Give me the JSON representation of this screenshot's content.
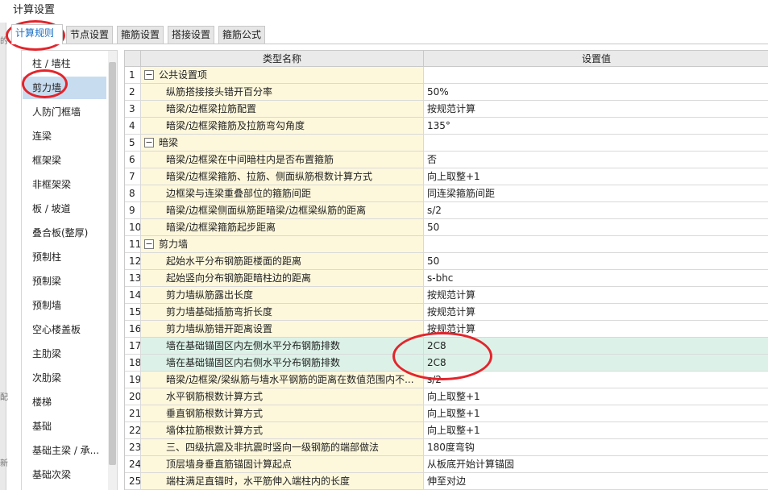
{
  "window": {
    "title": "计算设置"
  },
  "tabs": [
    {
      "label": "计算规则",
      "active": true
    },
    {
      "label": "节点设置",
      "active": false
    },
    {
      "label": "箍筋设置",
      "active": false
    },
    {
      "label": "搭接设置",
      "active": false
    },
    {
      "label": "箍筋公式",
      "active": false
    }
  ],
  "sidebar": {
    "selected": "剪力墙",
    "items": [
      {
        "label": "柱 / 墙柱"
      },
      {
        "label": "剪力墙"
      },
      {
        "label": "人防门框墙"
      },
      {
        "label": "连梁"
      },
      {
        "label": "框架梁"
      },
      {
        "label": "非框架梁"
      },
      {
        "label": "板 / 坡道"
      },
      {
        "label": "叠合板(整厚)"
      },
      {
        "label": "预制柱"
      },
      {
        "label": "预制梁"
      },
      {
        "label": "预制墙"
      },
      {
        "label": "空心楼盖板"
      },
      {
        "label": "主肋梁"
      },
      {
        "label": "次肋梁"
      },
      {
        "label": "楼梯"
      },
      {
        "label": "基础"
      },
      {
        "label": "基础主梁 / 承..."
      },
      {
        "label": "基础次梁"
      }
    ]
  },
  "grid": {
    "columns": {
      "name": "类型名称",
      "value": "设置值"
    },
    "rows": [
      {
        "num": "1",
        "name": "公共设置项",
        "value": "",
        "group": true,
        "toggle": "−"
      },
      {
        "num": "2",
        "name": "纵筋搭接接头错开百分率",
        "value": "50%"
      },
      {
        "num": "3",
        "name": "暗梁/边框梁拉筋配置",
        "value": "按规范计算"
      },
      {
        "num": "4",
        "name": "暗梁/边框梁箍筋及拉筋弯勾角度",
        "value": "135°"
      },
      {
        "num": "5",
        "name": "暗梁",
        "value": "",
        "group": true,
        "toggle": "−"
      },
      {
        "num": "6",
        "name": "暗梁/边框梁在中间暗柱内是否布置箍筋",
        "value": "否"
      },
      {
        "num": "7",
        "name": "暗梁/边框梁箍筋、拉筋、侧面纵筋根数计算方式",
        "value": "向上取整+1"
      },
      {
        "num": "8",
        "name": "边框梁与连梁重叠部位的箍筋间距",
        "value": "同连梁箍筋间距"
      },
      {
        "num": "9",
        "name": "暗梁/边框梁侧面纵筋距暗梁/边框梁纵筋的距离",
        "value": "s/2"
      },
      {
        "num": "10",
        "name": "暗梁/边框梁箍筋起步距离",
        "value": "50"
      },
      {
        "num": "11",
        "name": "剪力墙",
        "value": "",
        "group": true,
        "toggle": "−"
      },
      {
        "num": "12",
        "name": "起始水平分布钢筋距楼面的距离",
        "value": "50"
      },
      {
        "num": "13",
        "name": "起始竖向分布钢筋距暗柱边的距离",
        "value": "s-bhc"
      },
      {
        "num": "14",
        "name": "剪力墙纵筋露出长度",
        "value": "按规范计算"
      },
      {
        "num": "15",
        "name": "剪力墙基础插筋弯折长度",
        "value": "按规范计算"
      },
      {
        "num": "16",
        "name": "剪力墙纵筋错开距离设置",
        "value": "按规范计算"
      },
      {
        "num": "17",
        "name": "墙在基础锚固区内左侧水平分布钢筋排数",
        "value": "2C8",
        "highlight": true
      },
      {
        "num": "18",
        "name": "墙在基础锚固区内右侧水平分布钢筋排数",
        "value": "2C8",
        "highlight": true
      },
      {
        "num": "19",
        "name": "暗梁/边框梁/梁纵筋与墙水平钢筋的距离在数值范围内不...",
        "value": "s/2"
      },
      {
        "num": "20",
        "name": "水平钢筋根数计算方式",
        "value": "向上取整+1"
      },
      {
        "num": "21",
        "name": "垂直钢筋根数计算方式",
        "value": "向上取整+1"
      },
      {
        "num": "22",
        "name": "墙体拉筋根数计算方式",
        "value": "向上取整+1"
      },
      {
        "num": "23",
        "name": "三、四级抗震及非抗震时竖向一级钢筋的端部做法",
        "value": "180度弯钩"
      },
      {
        "num": "24",
        "name": "顶层墙身垂直筋锚固计算起点",
        "value": "从板底开始计算锚固"
      },
      {
        "num": "25",
        "name": "端柱满足直锚时，水平筋伸入端柱内的长度",
        "value": "伸至对边"
      }
    ]
  },
  "colors": {
    "tab_active_text": "#1a6fc4",
    "name_cell_bg": "#fdf8dc",
    "highlight_row_bg": "#dcf2e8",
    "sidebar_selected_bg": "#c8dcf0",
    "annotation_circle": "#e4242b"
  },
  "icons": {
    "group_toggle": "collapse-minus-icon"
  }
}
